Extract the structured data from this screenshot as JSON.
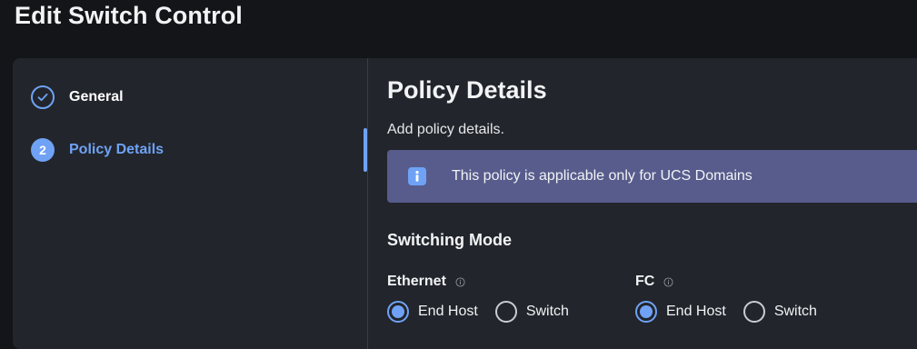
{
  "page": {
    "title": "Edit Switch Control"
  },
  "wizard": {
    "steps": [
      {
        "number": "1",
        "label": "General",
        "status": "completed",
        "icon": "check-icon"
      },
      {
        "number": "2",
        "label": "Policy Details",
        "status": "current"
      }
    ]
  },
  "content": {
    "title": "Policy Details",
    "subtitle": "Add policy details.",
    "info_banner": {
      "icon": "info-icon",
      "text": "This policy is applicable only for UCS Domains"
    },
    "section_title": "Switching Mode",
    "fields": [
      {
        "label": "Ethernet",
        "help_icon": "help-icon",
        "options": [
          "End Host",
          "Switch"
        ],
        "selected": "End Host"
      },
      {
        "label": "FC",
        "help_icon": "help-icon",
        "options": [
          "End Host",
          "Switch"
        ],
        "selected": "End Host"
      }
    ]
  },
  "colors": {
    "background": "#141518",
    "panel": "#22252b",
    "accent": "#6fa2f5",
    "banner": "#575c8c"
  }
}
